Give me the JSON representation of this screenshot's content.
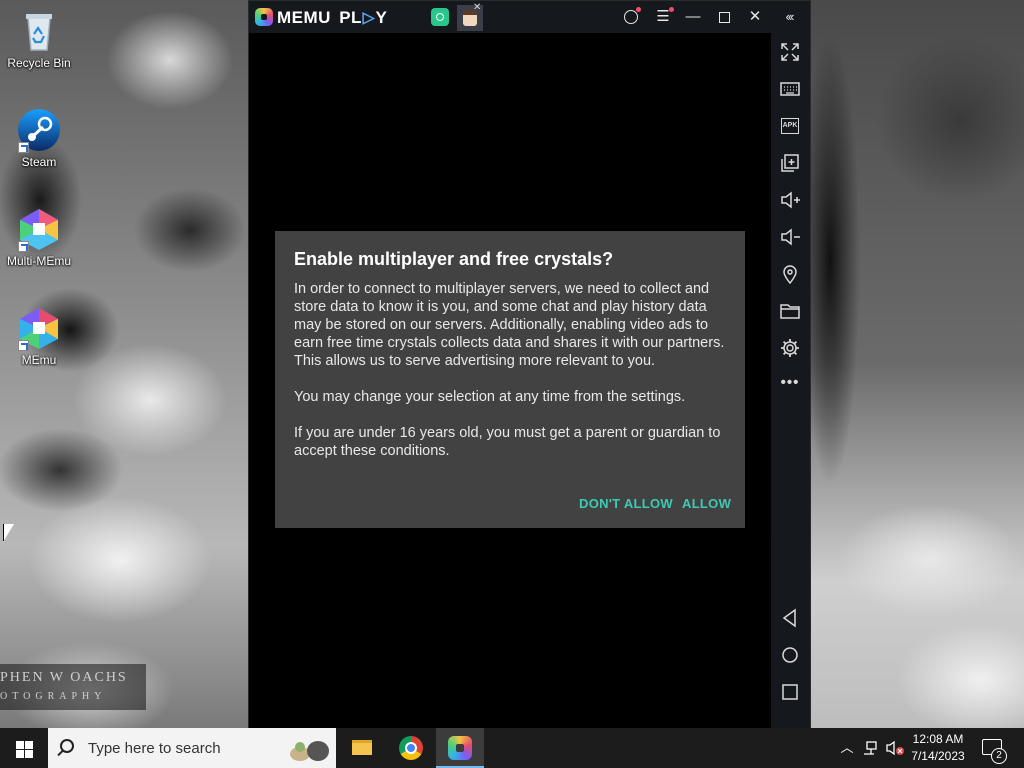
{
  "desktop": {
    "icons": [
      {
        "label": "Recycle Bin",
        "icon": "recycle-bin-icon"
      },
      {
        "label": "Steam",
        "icon": "steam-icon"
      },
      {
        "label": "Multi-MEmu",
        "icon": "multi-memu-icon"
      },
      {
        "label": "MEmu",
        "icon": "memu-icon"
      }
    ],
    "watermark": {
      "line1": "PHEN W OACHS",
      "line2": "OTOGRAPHY"
    }
  },
  "memu": {
    "brand_left": "MEMU",
    "brand_right": "PLAY",
    "titlebar_buttons": [
      "user-icon",
      "menu-icon",
      "minimize-icon",
      "maximize-icon",
      "close-icon",
      "collapse-icon"
    ],
    "sidebar_tools": [
      "fullscreen-icon",
      "keyboard-icon",
      "apk-icon",
      "multi-window-icon",
      "volume-up-icon",
      "volume-down-icon",
      "location-icon",
      "folder-icon",
      "settings-icon",
      "more-icon",
      "back-icon",
      "home-icon",
      "recents-icon"
    ],
    "sidebar_apk_label": "APK",
    "dialog": {
      "title": "Enable multiplayer and free crystals?",
      "paragraphs": [
        "In order to connect to multiplayer servers, we need to collect and store data to know it is you, and some chat and play history data may be stored on our servers. Additionally, enabling video ads to earn free time crystals collects data and shares it with our partners. This allows us to serve advertising more relevant to you.",
        "You may change your selection at any time from the settings.",
        "If you are under 16 years old, you must get a parent or guardian to accept these conditions."
      ],
      "deny_label": "DON'T ALLOW",
      "allow_label": "ALLOW",
      "accent_color": "#3fc9b3"
    }
  },
  "taskbar": {
    "search_placeholder": "Type here to search",
    "apps": [
      "file-explorer-icon",
      "chrome-icon",
      "memu-icon"
    ],
    "clock_time": "12:08 AM",
    "clock_date": "7/14/2023",
    "notification_count": "2"
  }
}
